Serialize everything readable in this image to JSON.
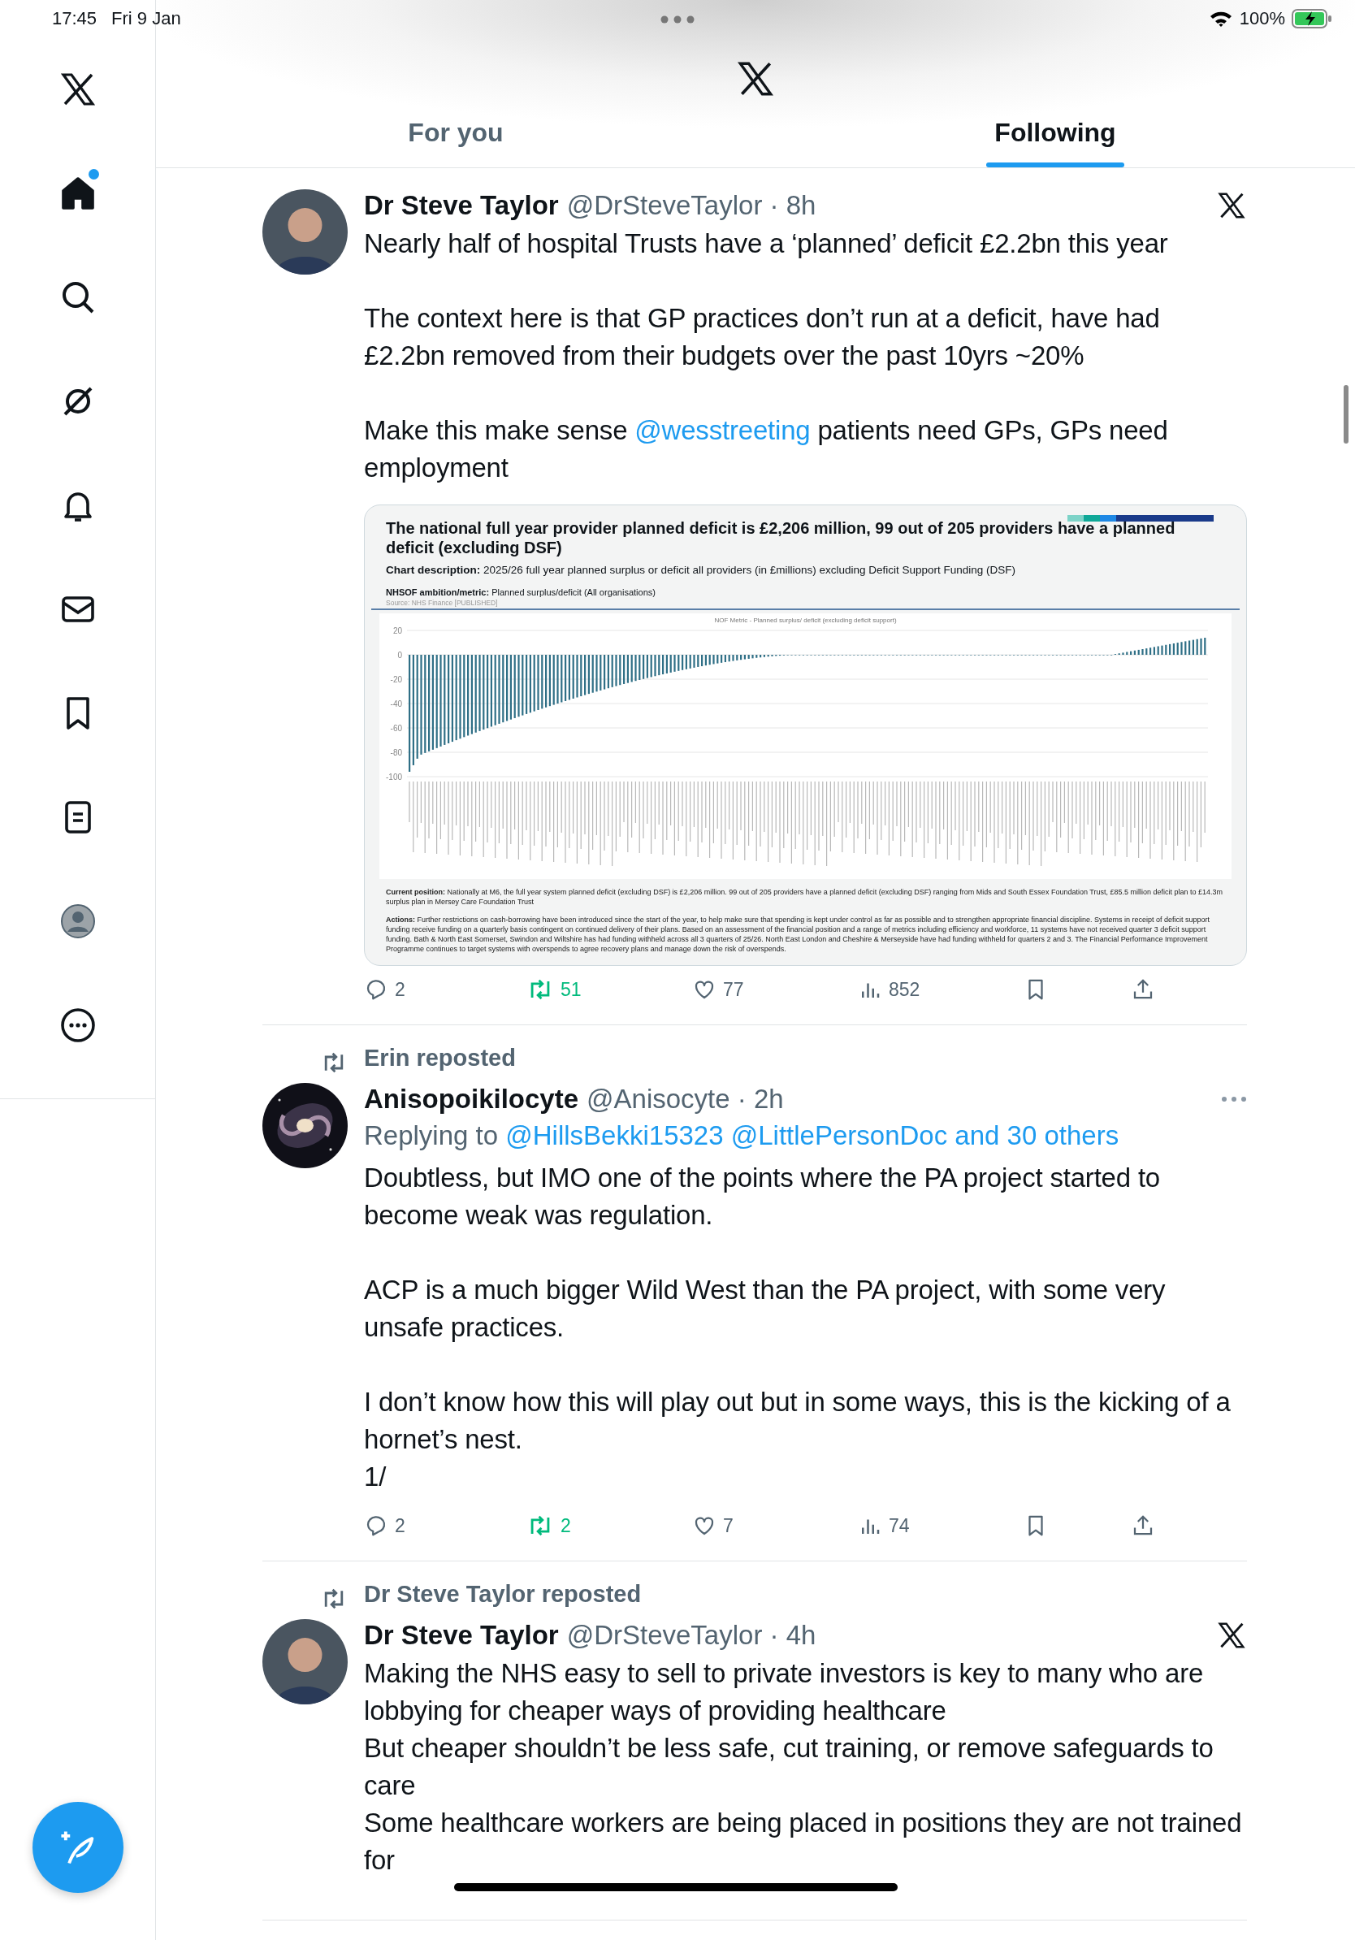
{
  "status_bar": {
    "time": "17:45",
    "date": "Fri 9 Jan",
    "battery": "100%"
  },
  "sidebar": {
    "items": [
      {
        "kind": "home",
        "selected": true,
        "unread": true
      },
      {
        "kind": "search",
        "selected": false,
        "unread": false
      },
      {
        "kind": "grok",
        "selected": false,
        "unread": false
      },
      {
        "kind": "bell",
        "selected": false,
        "unread": false
      },
      {
        "kind": "mail",
        "selected": false,
        "unread": false
      },
      {
        "kind": "bookmark",
        "selected": false,
        "unread": false
      },
      {
        "kind": "lists",
        "selected": false,
        "unread": false
      },
      {
        "kind": "profile",
        "selected": false,
        "unread": false
      },
      {
        "kind": "more",
        "selected": false,
        "unread": false
      }
    ]
  },
  "tabs": [
    {
      "label": "For you",
      "selected": false
    },
    {
      "label": "Following",
      "selected": true
    }
  ],
  "posts": [
    {
      "avatar": {
        "kind": "person"
      },
      "name": "Dr Steve Taylor",
      "handle_time": "@DrSteveTaylor · 8h",
      "menu": {
        "kind": "logo"
      },
      "paragraphs": [
        [
          {
            "text": "Nearly half of hospital Trusts have a ‘planned’ deficit £2.2bn this year"
          }
        ],
        [
          {
            "text": "The context here is that GP practices don’t run at a deficit, have had £2.2bn removed from their budgets over the past 10yrs ~20%"
          }
        ],
        [
          {
            "text": "Make this make sense "
          },
          {
            "text": "@wesstreeting",
            "kind": "mention"
          },
          {
            "text": " patients need GPs, GPs need employment"
          }
        ]
      ],
      "document": {
        "title": "The national full year provider planned deficit is £2,206 million, 99 out of 205 providers have a planned deficit (excluding DSF)",
        "description": "**Chart description:** 2025/26 full year planned surplus or deficit all providers (in £millions) excluding Deficit Support Funding (DSF)",
        "metric": "**NHSOF ambition/metric:** Planned surplus/deficit (All organisations)",
        "source": "Source: NHS Finance [PUBLISHED]",
        "chart_title": "NOF Metric - Planned surplus/ deficit (excluding deficit support)",
        "y_ticks": [
          "20",
          "0",
          "-20",
          "-40",
          "-60",
          "-80",
          "-100"
        ],
        "current_position": "**Current position:** Nationally at M6, the full year system planned deficit (excluding DSF) is £2,206 million. 99 out of 205 providers have a planned deficit (excluding DSF) ranging from Mids and South Essex Foundation Trust, £85.5 million deficit plan to £14.3m surplus plan in Mersey Care Foundation Trust",
        "actions": "**Actions:** Further restrictions on cash-borrowing have been introduced since the start of the year, to help make sure that spending is kept under control as far as possible and to strengthen appropriate financial discipline. Systems in receipt of deficit support funding receive funding on a quarterly basis contingent on continued delivery of their plans. Based on an assessment of the financial position and a range of metrics including efficiency and workforce, 11 systems have not received quarter 3 deficit support funding. Bath & North East Somerset, Swindon and Wiltshire has had funding withheld across all 3 quarters of 25/26. North East London and Cheshire & Merseyside have had funding withheld for quarters 2 and 3. The Financial Performance Improvement Programme continues to target systems with overspends to agree recovery plans and manage down the risk of overspends."
      },
      "stats": {
        "replies": "2",
        "reposts": "51",
        "likes": "77",
        "views": "852",
        "reposted": true
      }
    },
    {
      "repost_by": "Erin reposted",
      "avatar": {
        "kind": "picture"
      },
      "name": "Anisopoikilocyte",
      "handle_time": "@Anisocyte · 2h",
      "menu": {
        "kind": "more"
      },
      "replying": {
        "label": "Replying to",
        "mentions": "@HillsBekki15323 @LittlePersonDoc and 30 others"
      },
      "paragraphs": [
        [
          {
            "text": "Doubtless, but IMO one of the points where the PA project started to become weak was regulation."
          }
        ],
        [
          {
            "text": "ACP is a much bigger Wild West than the PA project, with some very unsafe practices."
          }
        ],
        [
          {
            "text": "I don’t know how this will play out but in some ways, this is the kicking of a hornet’s nest.\n1/"
          }
        ]
      ],
      "stats": {
        "replies": "2",
        "reposts": "2",
        "likes": "7",
        "views": "74",
        "reposted": true
      }
    },
    {
      "repost_by": "Dr Steve Taylor reposted",
      "avatar": {
        "kind": "person"
      },
      "name": "Dr Steve Taylor",
      "handle_time": "@DrSteveTaylor · 4h",
      "menu": {
        "kind": "logo"
      },
      "paragraphs": [
        [
          {
            "text": "Making the NHS easy to sell to private investors is key to many who are lobbying for cheaper ways of providing healthcare\nBut cheaper shouldn’t be less safe, cut training, or remove safeguards to care\nSome healthcare workers are being placed in positions they are not trained for"
          }
        ]
      ]
    }
  ]
}
